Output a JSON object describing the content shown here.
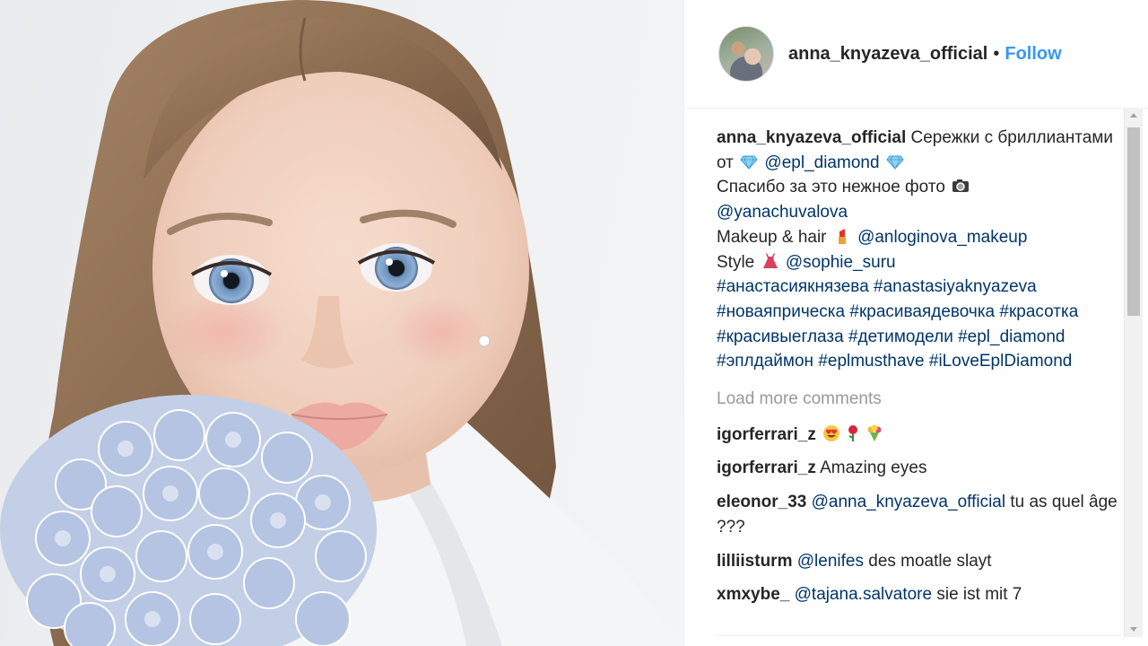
{
  "post": {
    "author": "anna_knyazeva_official",
    "separator": "•",
    "follow_label": "Follow"
  },
  "caption": {
    "username": "anna_knyazeva_official",
    "text1": "Сережки с бриллиантами от",
    "mention1": "@epl_diamond",
    "text2": "Спасибо за это нежное фото",
    "mention2": "@yanachuvalova",
    "text3": "Makeup & hair",
    "mention3": "@anloginova_makeup",
    "text4": "Style",
    "mention4": "@sophie_suru",
    "hashtags": [
      "#анастасиякнязева",
      "#anastasiyaknyazeva",
      "#новаяприческа",
      "#красиваядевочка",
      "#красотка",
      "#красивыеглаза",
      "#детимодели",
      "#epl_diamond",
      "#эплдаймон",
      "#eplmusthave",
      "#iLoveEplDiamond"
    ]
  },
  "load_more_label": "Load more comments",
  "comments": [
    {
      "username": "igorferrari_z",
      "mention": "",
      "text": ""
    },
    {
      "username": "igorferrari_z",
      "mention": "",
      "text": "Amazing eyes"
    },
    {
      "username": "eleonor_33",
      "mention": "@anna_knyazeva_official",
      "text": "tu as quel âge ???"
    },
    {
      "username": "lilliisturm",
      "mention": "@lenifes",
      "text": "des moatle slayt"
    },
    {
      "username": "xmxybe_",
      "mention": "@tajana.salvatore",
      "text": "sie ist mit 7"
    }
  ],
  "icons": {
    "diamond": "diamond-emoji",
    "camera": "camera-emoji",
    "lipstick": "lipstick-emoji",
    "dress": "dress-emoji",
    "heart_eyes": "heart-eyes-emoji",
    "rose": "rose-emoji",
    "bouquet": "bouquet-emoji"
  },
  "colors": {
    "link": "#003569",
    "follow": "#3897f0",
    "muted": "#999999",
    "text": "#262626"
  }
}
